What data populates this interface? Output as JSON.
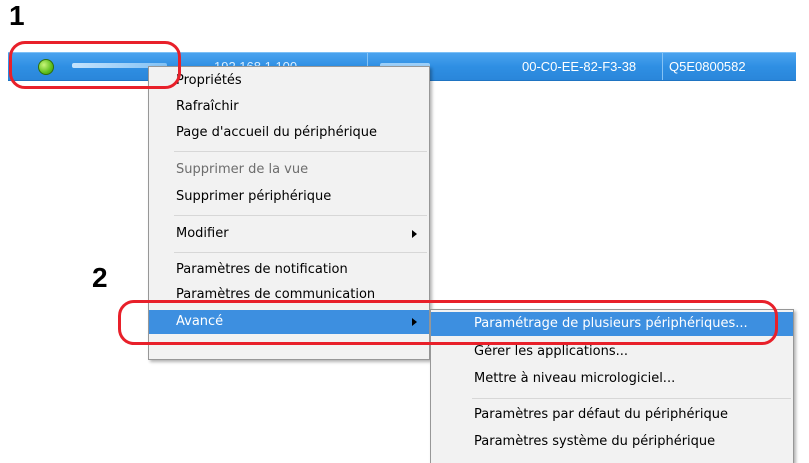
{
  "steps": {
    "step1": "1",
    "step2": "2"
  },
  "device_row": {
    "ip_address": "192.168.1.100",
    "mac_address": "00-C0-EE-82-F3-38",
    "serial_number": "Q5E0800582",
    "status_color": "#5fbf1e"
  },
  "context_menu": {
    "properties": "Propriétés",
    "refresh": "Rafraîchir",
    "device_home_page": "Page d'accueil du périphérique",
    "remove_from_view": "Supprimer de la vue",
    "delete_device": "Supprimer périphérique",
    "modify": "Modifier",
    "notification_settings": "Paramètres de notification",
    "communication_settings": "Paramètres de communication",
    "advanced": "Avancé"
  },
  "submenu": {
    "multi_device_setup": "Paramétrage de plusieurs périphériques...",
    "manage_applications": "Gérer les applications...",
    "firmware_upgrade": "Mettre à niveau micrologiciel...",
    "device_default_settings": "Paramètres par défaut du périphérique",
    "device_system_settings": "Paramètres système du périphérique"
  },
  "colors": {
    "highlight": "#3d8fe0",
    "callout": "#e8202a",
    "row": "#2f8fe3"
  }
}
